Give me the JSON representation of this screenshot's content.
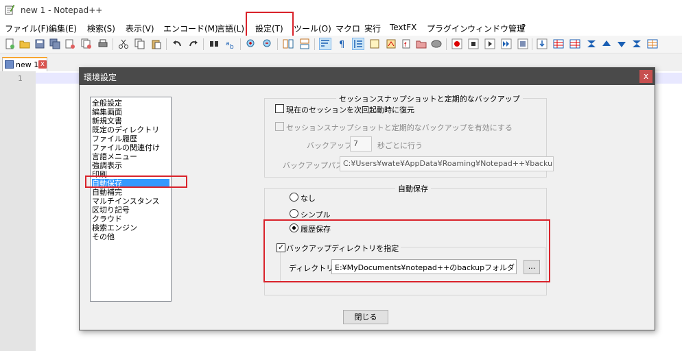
{
  "window": {
    "title": "new 1 - Notepad++"
  },
  "menu": [
    "ファイル(F)",
    "編集(E)",
    "検索(S)",
    "表示(V)",
    "エンコード(M)",
    "言語(L)",
    "設定(T)",
    "ツール(O)",
    "マクロ",
    "実行",
    "TextFX",
    "プラグイン",
    "ウィンドウ管理",
    "?"
  ],
  "tab": {
    "label": "new 1",
    "close": "x"
  },
  "editor": {
    "line_number": "1"
  },
  "dialog": {
    "title": "環境設定",
    "close": "x",
    "categories": [
      "全般設定",
      "編集画面",
      "新規文書",
      "既定のディレクトリ",
      "ファイル履歴",
      "ファイルの関連付け",
      "言語メニュー",
      "強調表示",
      "印刷",
      "自動保存",
      "自動補完",
      "マルチインスタンス",
      "区切り記号",
      "クラウド",
      "検索エンジン",
      "その他"
    ],
    "selected_category": "自動保存",
    "snapshot_group": {
      "title": "セッションスナップショットと定期的なバックアップ",
      "restore_session_label": "現在のセッションを次回起動時に復元",
      "enable_snapshot_label": "セッションスナップショットと定期的なバックアップを有効にする",
      "backup_every_label": "バックアップを",
      "backup_every_value": "7",
      "backup_every_suffix": "秒ごとに行う",
      "backup_path_label": "バックアップパス:",
      "backup_path_value": "C:¥Users¥wate¥AppData¥Roaming¥Notepad++¥backup¥"
    },
    "autosave_group": {
      "title": "自動保存",
      "option_none": "なし",
      "option_simple": "シンプル",
      "option_history": "履歴保存",
      "selected_option": "履歴保存",
      "specify_dir_label": "バックアップディレクトリを指定",
      "specify_dir_checked": true,
      "directory_label": "ディレクトリ:",
      "directory_value": "E:¥MyDocuments¥notepad++のbackupフォルダ",
      "browse_label": "..."
    },
    "close_button": "閉じる"
  },
  "colors": {
    "highlight": "#d9222a",
    "selection": "#3399ff",
    "dialog_title": "#4a4a4a"
  }
}
